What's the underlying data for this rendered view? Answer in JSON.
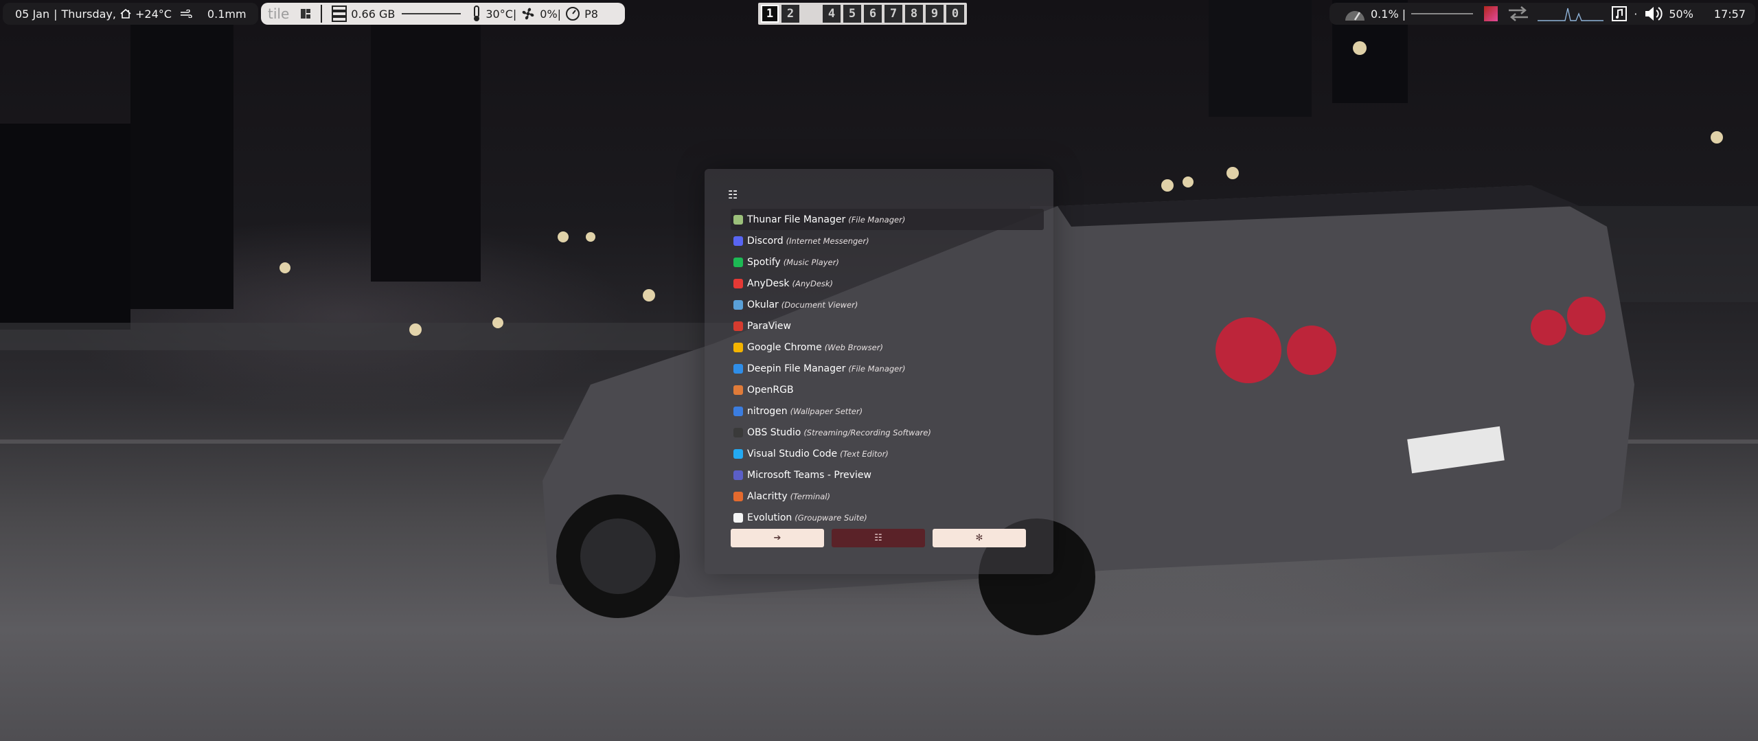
{
  "colors": {
    "bar_light": "#e8e5e4",
    "bar_dark": "#1d1c1f",
    "launcher_select": "#28262a",
    "mode_active": "#5a2228",
    "mode_idle": "#f7e6dc"
  },
  "topbar_left": {
    "date": "05 Jan",
    "day": "Thursday,",
    "weather_icon": "snowy-house-icon",
    "temperature": "+24°C",
    "wind_icon": "wind-icon",
    "precip": "0.1mm"
  },
  "topbar_system": {
    "layout": "tile",
    "layout_icon": "tile-layout-icon",
    "memory_icon": "server-icon",
    "memory": "0.66 GB",
    "thermometer_icon": "thermometer-icon",
    "cpu_temp": "30°C|",
    "fan_icon": "fan-icon",
    "fan": "0%|",
    "gauge_icon": "gauge-icon",
    "power": "P8"
  },
  "workspaces": [
    "1",
    "2",
    "3",
    "4",
    "5",
    "6",
    "7",
    "8",
    "9",
    "0"
  ],
  "workspace_active": "1",
  "topbar_right": {
    "cpu_icon": "speedometer-icon",
    "cpu": "0.1% |",
    "net_icon": "transfer-arrows-icon",
    "music_icon": "music-note-icon",
    "volume_icon": "speaker-icon",
    "volume": "50%",
    "time": "17:57"
  },
  "launcher": {
    "header_icon": "list-icon",
    "apps": [
      {
        "name": "Thunar File Manager",
        "desc": "(File Manager)",
        "icon": "folder-icon",
        "color": "#9bbf7a"
      },
      {
        "name": "Discord",
        "desc": "(Internet Messenger)",
        "icon": "discord-icon",
        "color": "#5865f2"
      },
      {
        "name": "Spotify",
        "desc": "(Music Player)",
        "icon": "spotify-icon",
        "color": "#1db954"
      },
      {
        "name": "AnyDesk",
        "desc": "(AnyDesk)",
        "icon": "anydesk-icon",
        "color": "#e53935"
      },
      {
        "name": "Okular",
        "desc": "(Document Viewer)",
        "icon": "okular-icon",
        "color": "#5aa0d8"
      },
      {
        "name": "ParaView",
        "desc": "",
        "icon": "paraview-icon",
        "color": "#d63b2f"
      },
      {
        "name": "Google Chrome",
        "desc": "(Web Browser)",
        "icon": "chrome-icon",
        "color": "#f4b400"
      },
      {
        "name": "Deepin File Manager",
        "desc": "(File Manager)",
        "icon": "deepin-folder-icon",
        "color": "#2f8ee8"
      },
      {
        "name": "OpenRGB",
        "desc": "",
        "icon": "openrgb-icon",
        "color": "#e07b39"
      },
      {
        "name": "nitrogen",
        "desc": "(Wallpaper Setter)",
        "icon": "nitrogen-icon",
        "color": "#3b7de0"
      },
      {
        "name": "OBS Studio",
        "desc": "(Streaming/Recording Software)",
        "icon": "obs-icon",
        "color": "#3a3a3a"
      },
      {
        "name": "Visual Studio Code",
        "desc": "(Text Editor)",
        "icon": "vscode-icon",
        "color": "#23a9f2"
      },
      {
        "name": "Microsoft Teams - Preview",
        "desc": "",
        "icon": "teams-icon",
        "color": "#5b5fc7"
      },
      {
        "name": "Alacritty",
        "desc": "(Terminal)",
        "icon": "alacritty-icon",
        "color": "#e46a2e"
      },
      {
        "name": "Evolution",
        "desc": "(Groupware Suite)",
        "icon": "evolution-icon",
        "color": "#f5f5f5"
      }
    ],
    "modes": [
      {
        "label": "➔",
        "icon": "run-arrow-icon",
        "active": false
      },
      {
        "label": "☷",
        "icon": "list-mode-icon",
        "active": true
      },
      {
        "label": "✻",
        "icon": "window-asterisk-icon",
        "active": false
      }
    ]
  }
}
